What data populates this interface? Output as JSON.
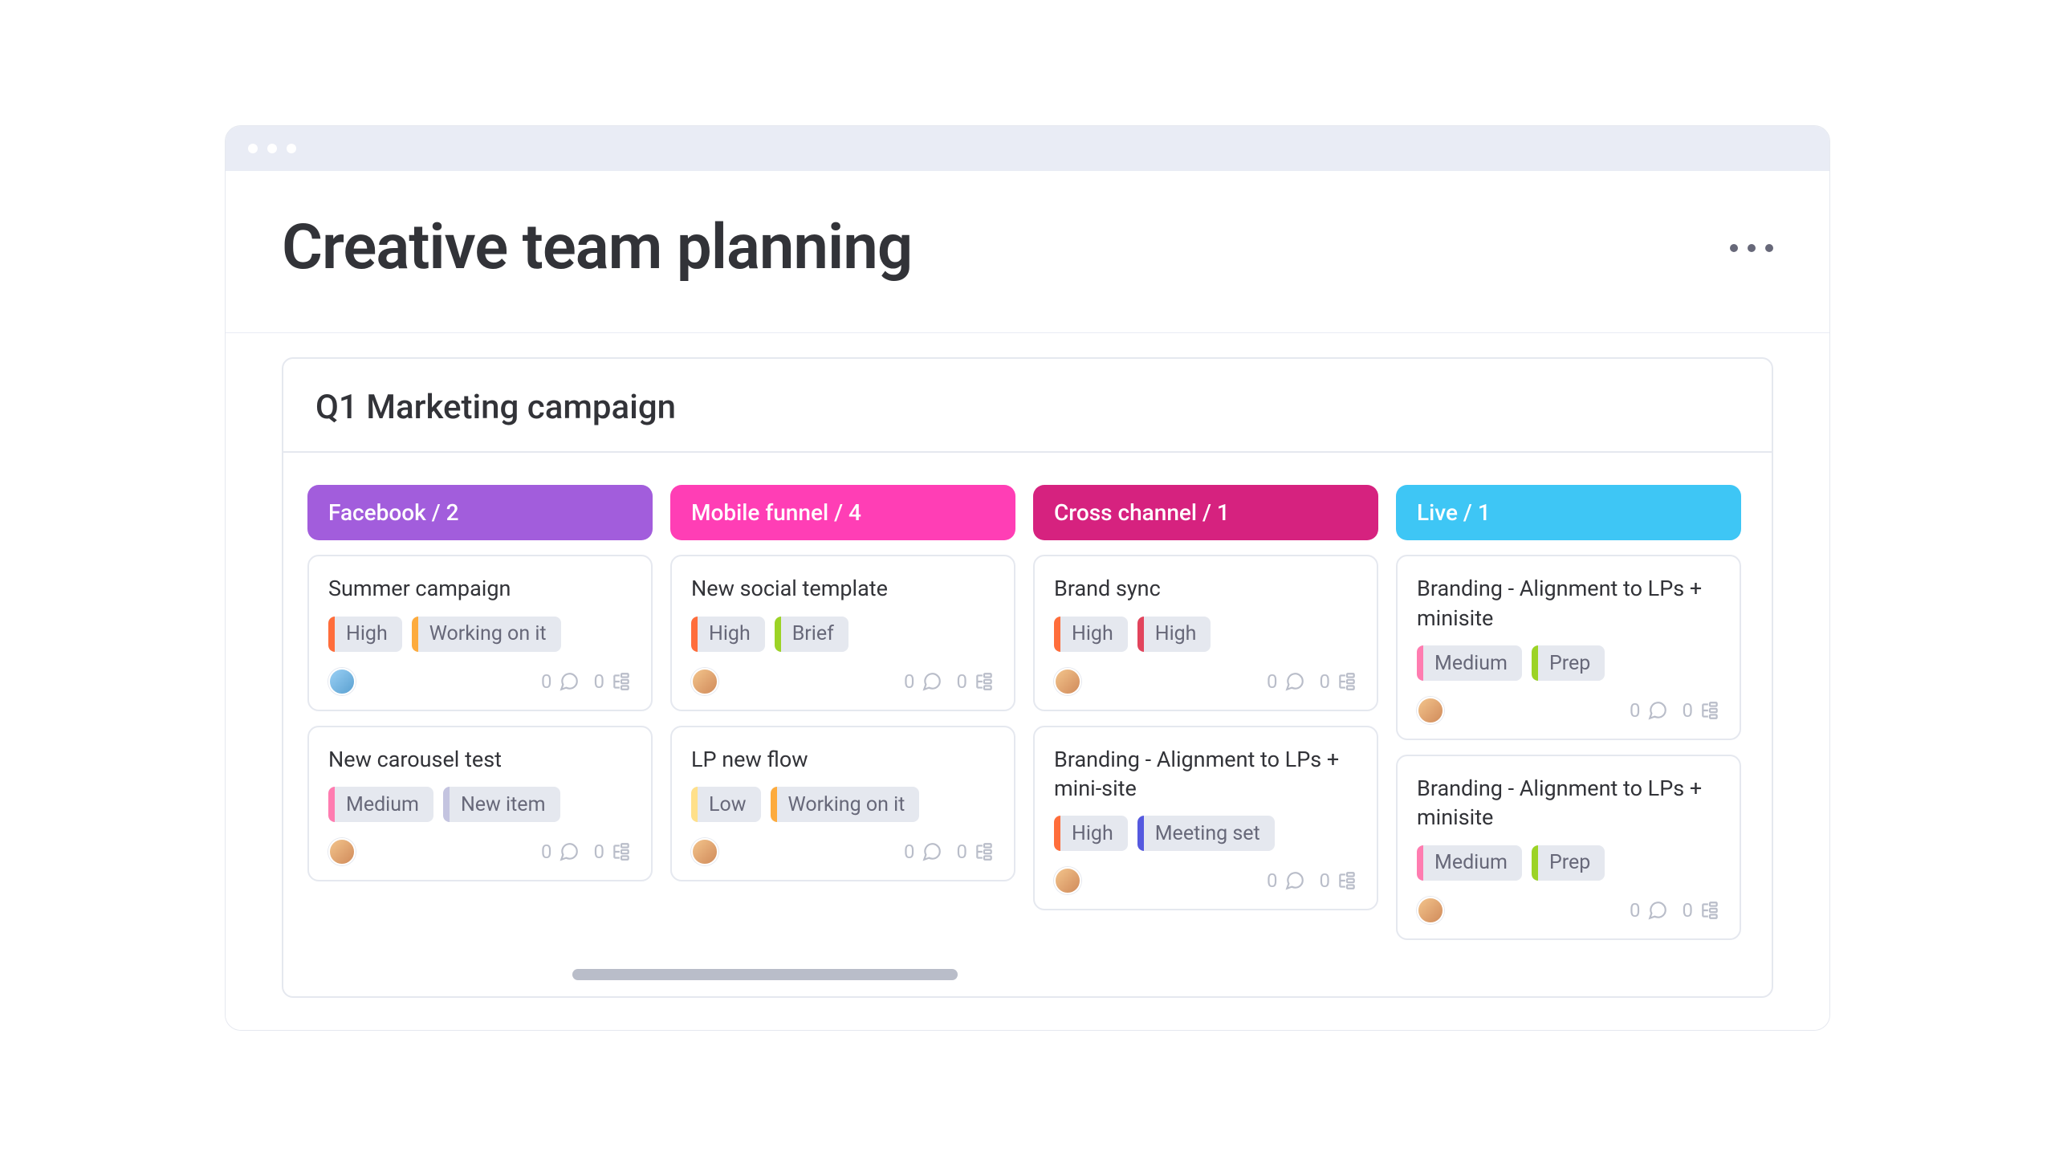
{
  "page_title": "Creative team planning",
  "board": {
    "title": "Q1 Marketing campaign",
    "columns": [
      {
        "name": "Facebook",
        "count": "2",
        "color": "#A25DDC",
        "cards": [
          {
            "title": "Summer campaign",
            "tags": [
              {
                "label": "High",
                "stripe": "#FF6D3B"
              },
              {
                "label": "Working on it",
                "stripe": "#FDAB3D"
              }
            ],
            "avatar_class": "a2",
            "comments": "0",
            "subitems": "0"
          },
          {
            "title": "New carousel test",
            "tags": [
              {
                "label": "Medium",
                "stripe": "#FF7CB0"
              },
              {
                "label": "New item",
                "stripe": "#C4C4E0"
              }
            ],
            "avatar_class": "",
            "comments": "0",
            "subitems": "0"
          }
        ]
      },
      {
        "name": "Mobile funnel",
        "count": "4",
        "color": "#FF3EB5",
        "cards": [
          {
            "title": "New social template",
            "tags": [
              {
                "label": "High",
                "stripe": "#FF6D3B"
              },
              {
                "label": "Brief",
                "stripe": "#9CD326"
              }
            ],
            "avatar_class": "",
            "comments": "0",
            "subitems": "0"
          },
          {
            "title": "LP new flow",
            "tags": [
              {
                "label": "Low",
                "stripe": "#FFE08A"
              },
              {
                "label": "Working on it",
                "stripe": "#FDAB3D"
              }
            ],
            "avatar_class": "",
            "comments": "0",
            "subitems": "0"
          }
        ]
      },
      {
        "name": "Cross channel",
        "count": "1",
        "color": "#D6227F",
        "cards": [
          {
            "title": "Brand sync",
            "tags": [
              {
                "label": "High",
                "stripe": "#FF6D3B"
              },
              {
                "label": "High",
                "stripe": "#E2445C"
              }
            ],
            "avatar_class": "",
            "comments": "0",
            "subitems": "0"
          },
          {
            "title": "Branding  - Alignment to LPs + mini-site",
            "tags": [
              {
                "label": "High",
                "stripe": "#FF6D3B"
              },
              {
                "label": "Meeting set",
                "stripe": "#5559DF"
              }
            ],
            "avatar_class": "",
            "comments": "0",
            "subitems": "0"
          }
        ]
      },
      {
        "name": "Live",
        "count": "1",
        "color": "#3EC6F5",
        "cards": [
          {
            "title": "Branding  - Alignment to LPs + minisite",
            "tags": [
              {
                "label": "Medium",
                "stripe": "#FF7CB0"
              },
              {
                "label": "Prep",
                "stripe": "#9CD326"
              }
            ],
            "avatar_class": "",
            "comments": "0",
            "subitems": "0"
          },
          {
            "title": "Branding  - Alignment to LPs + minisite",
            "tags": [
              {
                "label": "Medium",
                "stripe": "#FF7CB0"
              },
              {
                "label": "Prep",
                "stripe": "#9CD326"
              }
            ],
            "avatar_class": "",
            "comments": "0",
            "subitems": "0"
          }
        ]
      }
    ]
  }
}
